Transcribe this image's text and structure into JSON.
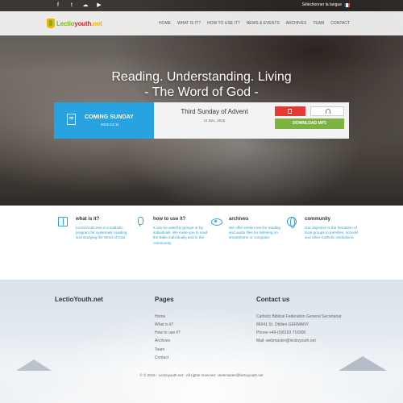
{
  "topbar": {
    "social_icons": [
      "facebook-icon",
      "twitter-icon",
      "soundcloud-icon",
      "youtube-icon"
    ],
    "language_label": "Sélectionner la langue",
    "flag_colors": [
      "#0055a4",
      "#ffffff",
      "#ef4135"
    ]
  },
  "nav": {
    "logo_prefix": "Lectio",
    "logo_middle": "youth",
    "logo_suffix": ".net",
    "items": [
      {
        "label": "HOME"
      },
      {
        "label": "WHAT IS IT?"
      },
      {
        "label": "HOW TO USE IT?"
      },
      {
        "label": "NEWS & EVENTS"
      },
      {
        "label": "ARCHIVES"
      },
      {
        "label": "TEAM"
      },
      {
        "label": "CONTACT"
      }
    ]
  },
  "hero": {
    "line1": "Reading. Understanding. Living",
    "line2": "- The Word of God -"
  },
  "event": {
    "coming_label": "COMING SUNDAY",
    "coming_date": "2016-12-11",
    "title": "Third Sunday of Advent",
    "date": "11 Dec, 2016",
    "download_label": "DOWNLOAD MP3",
    "colors": {
      "blue": "#29a3e0",
      "red": "#e53935",
      "green": "#7cb342"
    }
  },
  "features": [
    {
      "title": "what is it?",
      "text": "LectioYouth.Net is a Catholic program for systematic reading and studying the Word of God.",
      "icon": "book-icon"
    },
    {
      "title": "how to use it?",
      "text": "It can be used by groups or by individuals. We invite you to read the Bible individually and in the community.",
      "icon": "microphone-icon"
    },
    {
      "title": "archives",
      "text": "We offer written text for reading and audio files for listening on smartphone or computer.",
      "icon": "eye-icon"
    },
    {
      "title": "community",
      "text": "Our objective is the formation of local groups in parishes, schools and other Catholic institutions.",
      "icon": "globe-icon"
    }
  ],
  "footer": {
    "brand": "LectioYouth.net",
    "pages_title": "Pages",
    "pages": [
      "Home",
      "What is it?",
      "How to use it?",
      "Archives",
      "Team",
      "Contact"
    ],
    "contact_title": "Contact us",
    "contact_lines": [
      "Catholic Biblical Federation General Secretariat",
      "86941 St. Ottilien GERMANY",
      "Phone:+49-(0)8193 716900",
      "Mail: webmaster@lectioyouth.net"
    ],
    "copyright": "© © 2016 - Lectioyouth.net - All rights reserved - webmaster@lectioyouth.net"
  }
}
